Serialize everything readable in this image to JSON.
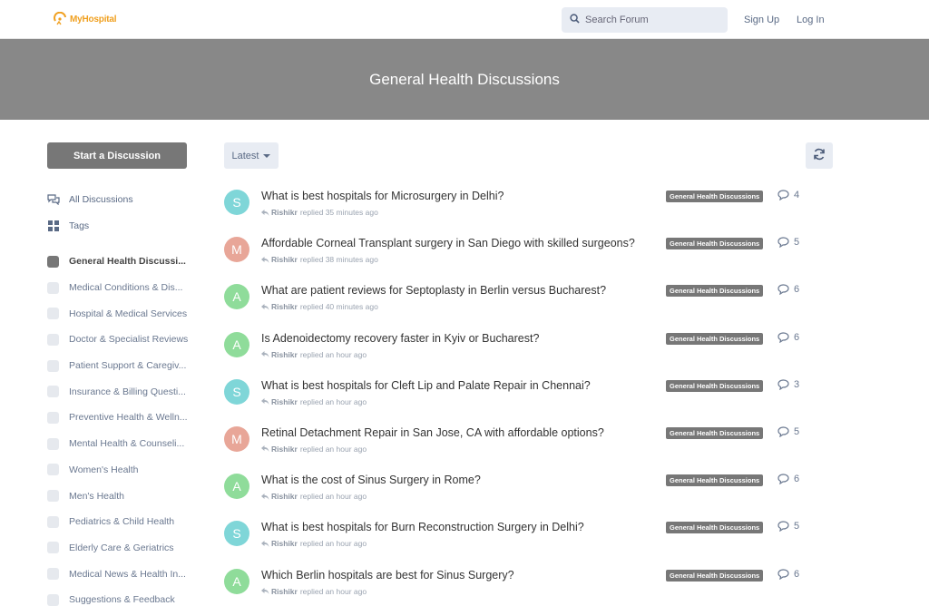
{
  "header": {
    "logo_text": "MyHospital",
    "search_placeholder": "Search Forum",
    "signup": "Sign Up",
    "login": "Log In"
  },
  "hero": {
    "title": "General Health Discussions"
  },
  "sidebar": {
    "start_button": "Start a Discussion",
    "nav": [
      {
        "label": "All Discussions",
        "icon": "chat-bubbles-icon"
      },
      {
        "label": "Tags",
        "icon": "grid-icon"
      }
    ],
    "tags": [
      {
        "label": "General Health Discussi...",
        "active": true
      },
      {
        "label": "Medical Conditions & Dis..."
      },
      {
        "label": "Hospital & Medical Services"
      },
      {
        "label": "Doctor & Specialist Reviews"
      },
      {
        "label": "Patient Support & Caregiv..."
      },
      {
        "label": "Insurance & Billing Questi..."
      },
      {
        "label": "Preventive Health & Welln..."
      },
      {
        "label": "Mental Health & Counseli..."
      },
      {
        "label": "Women's Health"
      },
      {
        "label": "Men's Health"
      },
      {
        "label": "Pediatrics & Child Health"
      },
      {
        "label": "Elderly Care & Geriatrics"
      },
      {
        "label": "Medical News & Health In..."
      },
      {
        "label": "Suggestions & Feedback"
      }
    ]
  },
  "toolbar": {
    "sort_label": "Latest",
    "refresh_icon": "refresh-icon"
  },
  "discussions": [
    {
      "initial": "S",
      "color": "#7fd6d8",
      "title": "What is best hospitals for Microsurgery in Delhi?",
      "user": "Rishikr",
      "action": "replied 35 minutes ago",
      "tag": "General Health Discussions",
      "replies": "4"
    },
    {
      "initial": "M",
      "color": "#e8a698",
      "title": "Affordable Corneal Transplant surgery in San Diego with skilled surgeons?",
      "user": "Rishikr",
      "action": "replied 38 minutes ago",
      "tag": "General Health Discussions",
      "replies": "5"
    },
    {
      "initial": "A",
      "color": "#8fdc9a",
      "title": "What are patient reviews for Septoplasty in Berlin versus Bucharest?",
      "user": "Rishikr",
      "action": "replied 40 minutes ago",
      "tag": "General Health Discussions",
      "replies": "6"
    },
    {
      "initial": "A",
      "color": "#8fdc9a",
      "title": "Is Adenoidectomy recovery faster in Kyiv or Bucharest?",
      "user": "Rishikr",
      "action": "replied an hour ago",
      "tag": "General Health Discussions",
      "replies": "6"
    },
    {
      "initial": "S",
      "color": "#7fd6d8",
      "title": "What is best hospitals for Cleft Lip and Palate Repair in Chennai?",
      "user": "Rishikr",
      "action": "replied an hour ago",
      "tag": "General Health Discussions",
      "replies": "3"
    },
    {
      "initial": "M",
      "color": "#e8a698",
      "title": "Retinal Detachment Repair in San Jose, CA with affordable options?",
      "user": "Rishikr",
      "action": "replied an hour ago",
      "tag": "General Health Discussions",
      "replies": "5"
    },
    {
      "initial": "A",
      "color": "#8fdc9a",
      "title": "What is the cost of Sinus Surgery in Rome?",
      "user": "Rishikr",
      "action": "replied an hour ago",
      "tag": "General Health Discussions",
      "replies": "6"
    },
    {
      "initial": "S",
      "color": "#7fd6d8",
      "title": "What is best hospitals for Burn Reconstruction Surgery in Delhi?",
      "user": "Rishikr",
      "action": "replied an hour ago",
      "tag": "General Health Discussions",
      "replies": "5"
    },
    {
      "initial": "A",
      "color": "#8fdc9a",
      "title": "Which Berlin hospitals are best for Sinus Surgery?",
      "user": "Rishikr",
      "action": "replied an hour ago",
      "tag": "General Health Discussions",
      "replies": "6"
    }
  ]
}
